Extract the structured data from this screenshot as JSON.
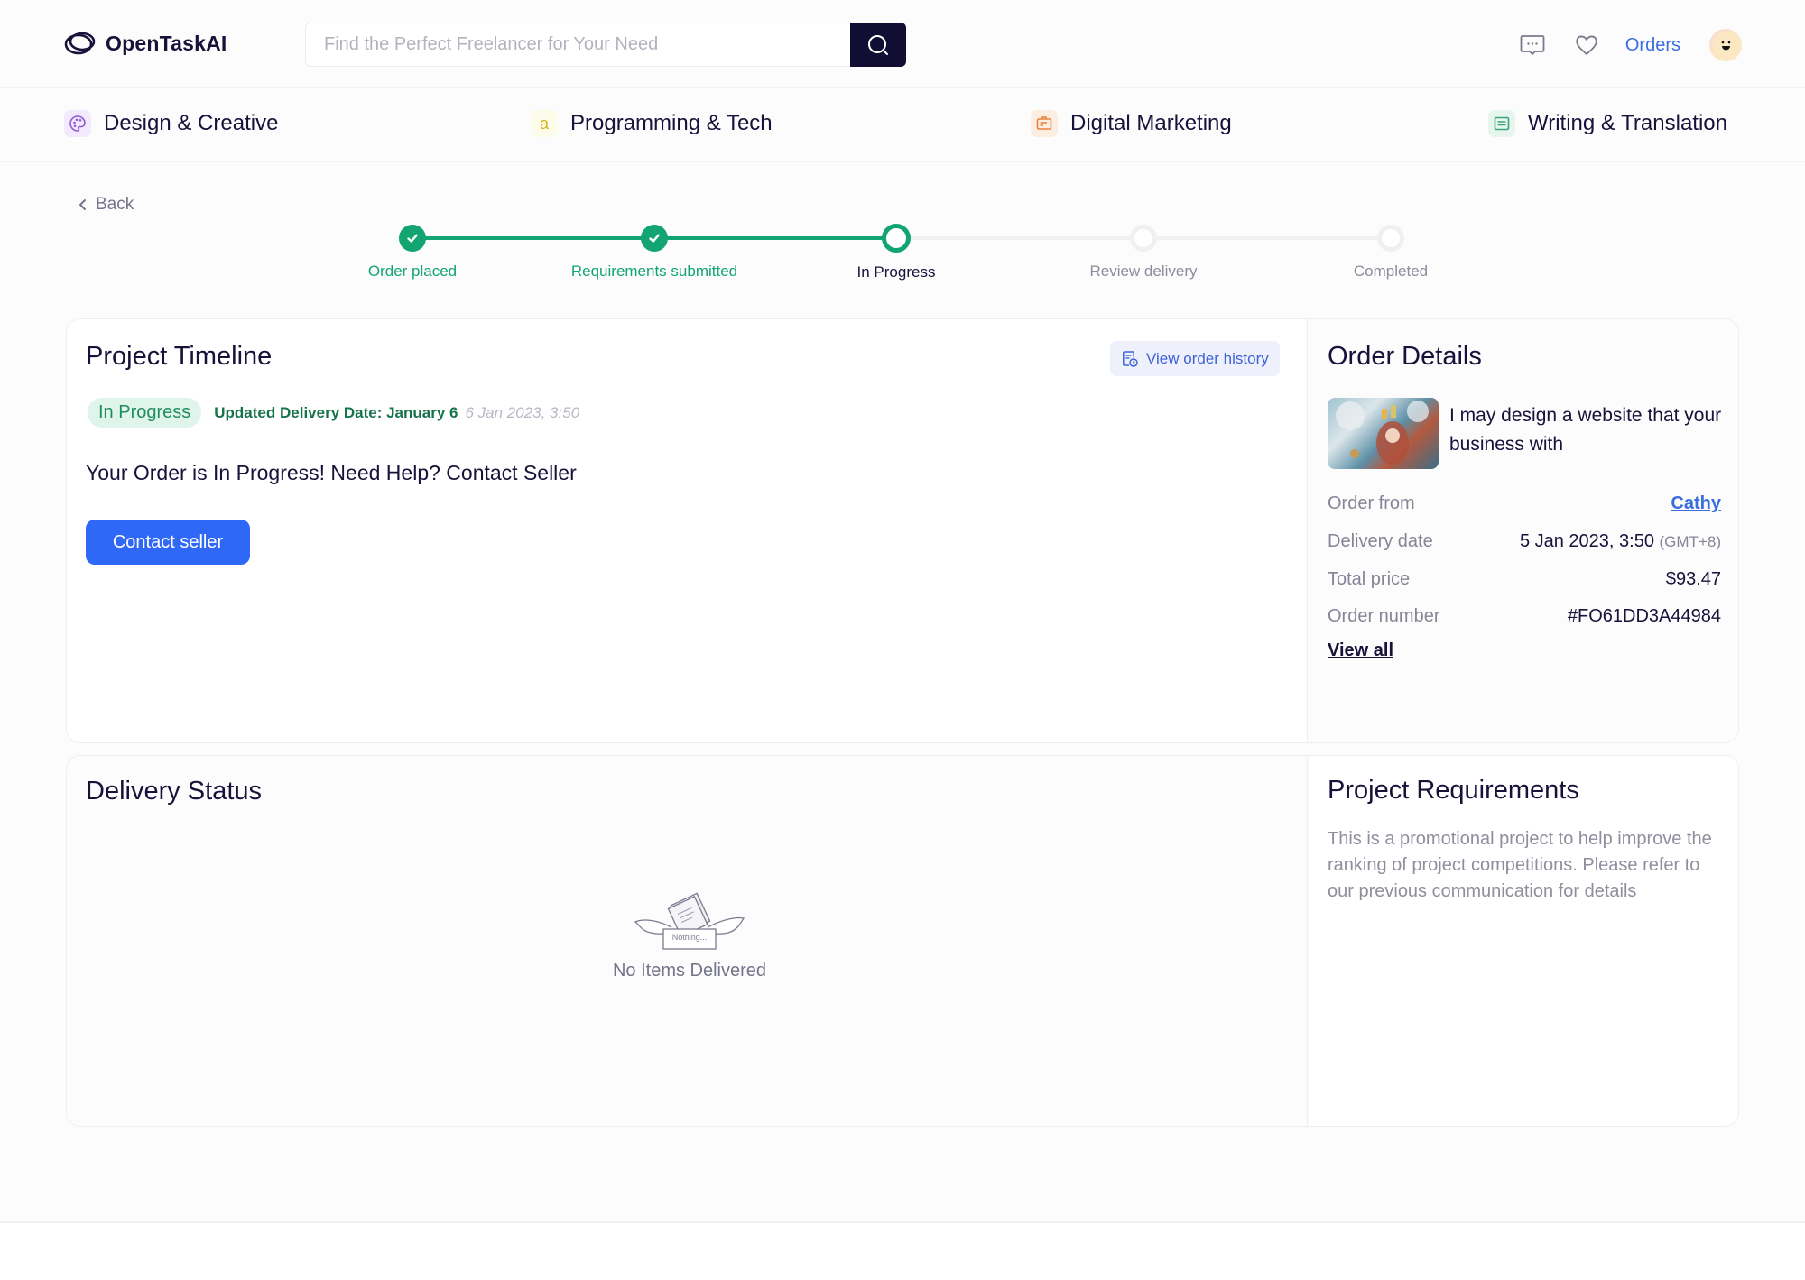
{
  "header": {
    "brand": "OpenTaskAI",
    "search_placeholder": "Find the Perfect Freelancer for Your Need",
    "search_value": "",
    "orders_label": "Orders",
    "icons": [
      "messages-icon",
      "heart-icon",
      "search-icon",
      "avatar"
    ]
  },
  "categories": [
    {
      "label": "Design & Creative",
      "icon": "palette-icon",
      "color": "#8e5bd6"
    },
    {
      "label": "Programming & Tech",
      "icon": "letter-a-icon",
      "glyph": "a",
      "color": "#d4b21c"
    },
    {
      "label": "Digital Marketing",
      "icon": "id-card-icon",
      "color": "#e8843a"
    },
    {
      "label": "Writing & Translation",
      "icon": "document-icon",
      "color": "#3aa37a"
    }
  ],
  "back_label": "Back",
  "stepper": {
    "steps": [
      {
        "label": "Order placed",
        "state": "done"
      },
      {
        "label": "Requirements submitted",
        "state": "done"
      },
      {
        "label": "In Progress",
        "state": "current"
      },
      {
        "label": "Review delivery",
        "state": "future"
      },
      {
        "label": "Completed",
        "state": "future"
      }
    ],
    "accent": "#12a572"
  },
  "timeline": {
    "title": "Project Timeline",
    "history_button": "View order history",
    "status_badge": "In Progress",
    "updated_delivery": "Updated Delivery Date: January 6",
    "updated_timestamp": "6 Jan 2023, 3:50",
    "message": "Your Order is In Progress! Need Help? Contact Seller",
    "contact_button": "Contact seller"
  },
  "order_details": {
    "title": "Order Details",
    "gig_title": "I may design a website that your business with",
    "rows": [
      {
        "label": "Order from",
        "value": "Cathy",
        "is_link": true
      },
      {
        "label": "Delivery date",
        "value": "5 Jan 2023, 3:50",
        "suffix": "(GMT+8)"
      },
      {
        "label": "Total price",
        "value": "$93.47"
      },
      {
        "label": "Order number",
        "value": "#FO61DD3A44984"
      }
    ],
    "view_all": "View all"
  },
  "delivery": {
    "title": "Delivery Status",
    "empty_box_label": "Nothing...",
    "empty_label": "No Items Delivered"
  },
  "requirements": {
    "title": "Project Requirements",
    "text": "This is a promotional project to help improve the ranking of project competitions. Please refer to our previous communication for details"
  },
  "colors": {
    "primary": "#2f67f6",
    "brand_dark": "#110d33",
    "success": "#12a572",
    "link": "#3a6ee0"
  }
}
